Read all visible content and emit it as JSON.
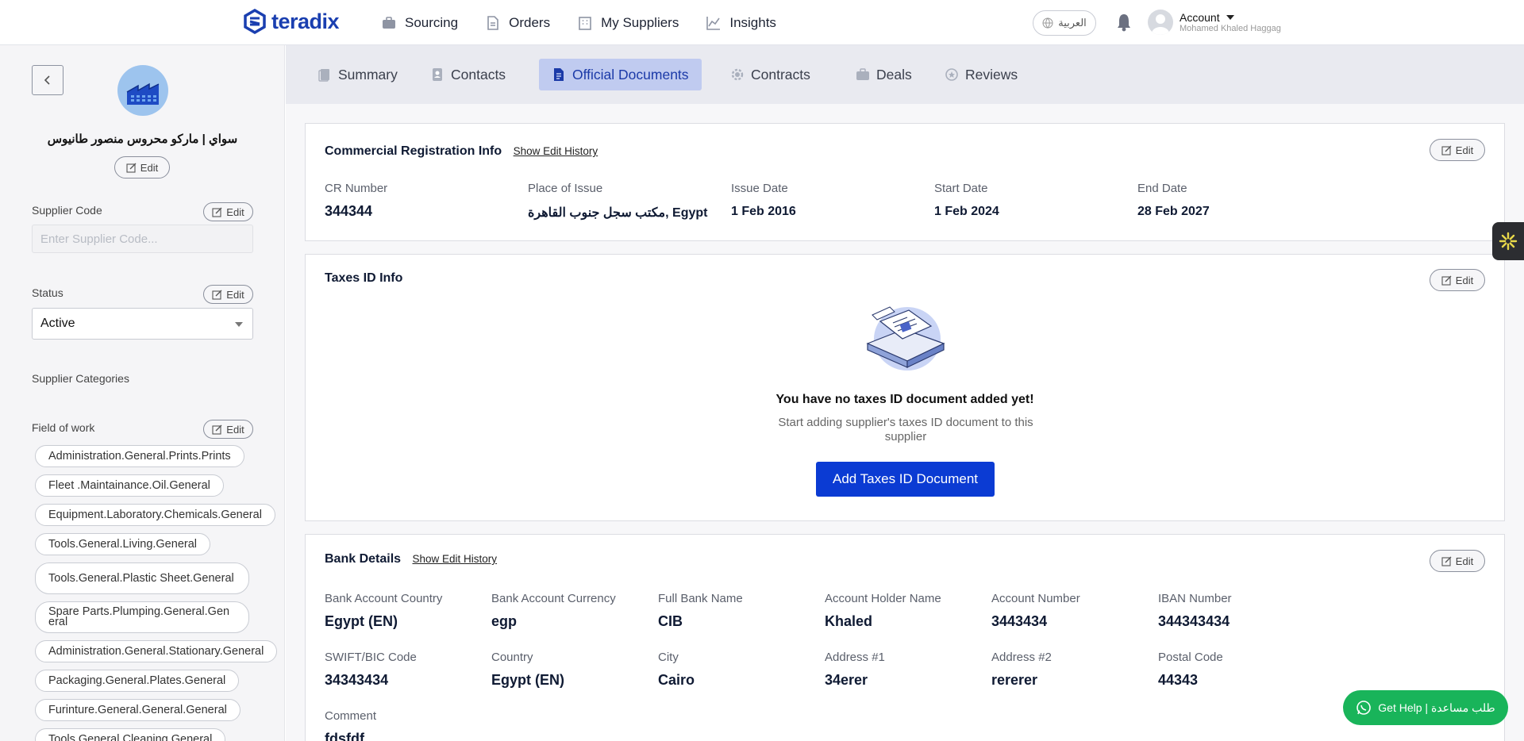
{
  "brand": {
    "name": "teradix",
    "color": "#1a3fb0"
  },
  "nav": {
    "items": [
      {
        "label": "Sourcing",
        "icon": "briefcase-icon"
      },
      {
        "label": "Orders",
        "icon": "document-icon"
      },
      {
        "label": "My Suppliers",
        "icon": "building-icon"
      },
      {
        "label": "Insights",
        "icon": "chart-line-icon"
      }
    ],
    "language": "العربية",
    "account_label": "Account",
    "account_user": "Mohamed Khaled Haggag"
  },
  "sidebar": {
    "supplier_name": "سواي | ماركو محروس منصور طانيوس",
    "edit_label": "Edit",
    "supplier_code_label": "Supplier Code",
    "supplier_code_placeholder": "Enter Supplier Code...",
    "status_label": "Status",
    "status_value": "Active",
    "categories_label": "Supplier Categories",
    "field_of_work_label": "Field of work",
    "field_of_work": [
      "Administration.General.Prints.Prints",
      "Fleet .Maintainance.Oil.General",
      "Equipment.Laboratory.Chemicals.General",
      "Tools.General.Living.General",
      "Tools.General.Plastic Sheet.General",
      "Spare Parts.Plumping.General.General",
      "Administration.General.Stationary.General",
      "Packaging.General.Plates.General",
      "Furinture.General.General.General",
      "Tools.General.Cleaning.General"
    ]
  },
  "tabs": [
    {
      "label": "Summary",
      "icon": "summary-icon",
      "active": false
    },
    {
      "label": "Contacts",
      "icon": "contact-card-icon",
      "active": false
    },
    {
      "label": "Official Documents",
      "icon": "official-document-icon",
      "active": true
    },
    {
      "label": "Contracts",
      "icon": "gear-icon",
      "active": false
    },
    {
      "label": "Deals",
      "icon": "briefcase-icon",
      "active": false
    },
    {
      "label": "Reviews",
      "icon": "review-icon",
      "active": false
    }
  ],
  "commercial": {
    "title": "Commercial Registration Info",
    "history_link": "Show Edit History",
    "edit_label": "Edit",
    "fields": [
      {
        "label": "CR Number",
        "value": "344344"
      },
      {
        "label": "Place of Issue",
        "value": "مكتب سجل جنوب القاهرة, Egypt"
      },
      {
        "label": "Issue Date",
        "value": "1 Feb 2016"
      },
      {
        "label": "Start Date",
        "value": "1 Feb 2024"
      },
      {
        "label": "End Date",
        "value": "28 Feb 2027"
      }
    ]
  },
  "taxes": {
    "title": "Taxes ID Info",
    "edit_label": "Edit",
    "empty_title": "You have no taxes ID document added yet!",
    "empty_subtitle": "Start adding supplier's taxes ID document to this supplier",
    "add_button": "Add Taxes ID Document"
  },
  "bank": {
    "title": "Bank Details",
    "history_link": "Show Edit History",
    "edit_label": "Edit",
    "fields": [
      {
        "label": "Bank Account Country",
        "value": "Egypt (EN)"
      },
      {
        "label": "Bank Account Currency",
        "value": "egp"
      },
      {
        "label": "Full Bank Name",
        "value": "CIB"
      },
      {
        "label": "Account Holder Name",
        "value": "Khaled"
      },
      {
        "label": "Account Number",
        "value": "3443434"
      },
      {
        "label": "IBAN Number",
        "value": "344343434"
      },
      {
        "label": "SWIFT/BIC Code",
        "value": "34343434"
      },
      {
        "label": "Country",
        "value": "Egypt (EN)"
      },
      {
        "label": "City",
        "value": "Cairo"
      },
      {
        "label": "Address #1",
        "value": "34erer"
      },
      {
        "label": "Address #2",
        "value": "rererer"
      },
      {
        "label": "Postal Code",
        "value": "44343"
      },
      {
        "label": "Comment",
        "value": "fdsfdf"
      }
    ]
  },
  "help": {
    "label": "Get Help | طلب مساعدة",
    "color": "#19b45a"
  },
  "colors": {
    "accent": "#0b3bd3",
    "active_tab_bg": "#c0cbf0"
  }
}
